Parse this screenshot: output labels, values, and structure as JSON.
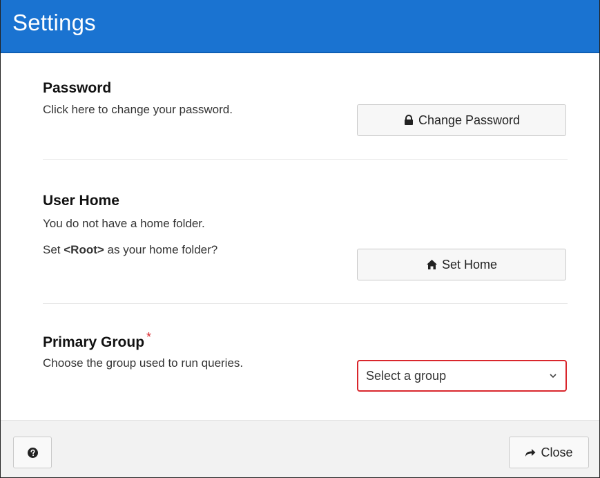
{
  "window": {
    "title": "Settings"
  },
  "password": {
    "heading": "Password",
    "description": "Click here to change your password.",
    "button_label": "Change Password",
    "button_icon": "lock-icon"
  },
  "user_home": {
    "heading": "User Home",
    "status": "You do not have a home folder.",
    "prompt_prefix": "Set ",
    "prompt_root": "<Root>",
    "prompt_suffix": " as your home folder?",
    "button_label": "Set Home",
    "button_icon": "home-icon"
  },
  "primary_group": {
    "heading": "Primary Group",
    "required_marker": "*",
    "description": "Choose the group used to run queries.",
    "select_placeholder": "Select a group"
  },
  "footer": {
    "help_icon": "question-circle-icon",
    "close_label": "Close",
    "close_icon": "share-arrow-icon"
  },
  "colors": {
    "titlebar": "#1a73d1",
    "required": "#d9262c"
  }
}
